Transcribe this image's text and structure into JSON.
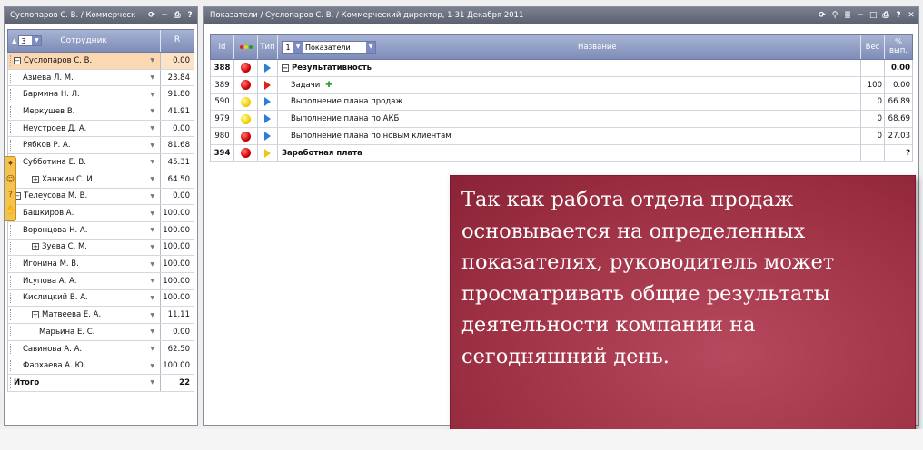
{
  "left_panel": {
    "title": "Суслопаров С. В. / Коммерческ",
    "header": {
      "level_value": "3",
      "employee_col": "Сотрудник",
      "r_col": "R"
    },
    "rows": [
      {
        "name": "Суслопаров С. В.",
        "value": "0.00",
        "expander": "−",
        "indent": 0,
        "selected": true
      },
      {
        "name": "Азиева Л. М.",
        "value": "23.84",
        "indent": 1
      },
      {
        "name": "Бармина Н. Л.",
        "value": "91.80",
        "indent": 1
      },
      {
        "name": "Меркушев В.",
        "value": "41.91",
        "indent": 1
      },
      {
        "name": "Неустроев Д. А.",
        "value": "0.00",
        "indent": 1
      },
      {
        "name": "Рябков Р. А.",
        "value": "81.68",
        "indent": 1
      },
      {
        "name": "Субботина Е. В.",
        "value": "45.31",
        "indent": 1
      },
      {
        "name": "Ханжин С. И.",
        "value": "64.50",
        "expander": "+",
        "indent": 2
      },
      {
        "name": "Телеусова М. В.",
        "value": "0.00",
        "expander": "−",
        "indent": 0
      },
      {
        "name": "Башкиров А.",
        "value": "100.00",
        "indent": 1
      },
      {
        "name": "Воронцова Н. А.",
        "value": "100.00",
        "indent": 1
      },
      {
        "name": "Зуева С. М.",
        "value": "100.00",
        "expander": "+",
        "indent": 2
      },
      {
        "name": "Игонина М. В.",
        "value": "100.00",
        "indent": 1
      },
      {
        "name": "Исупова А. А.",
        "value": "100.00",
        "indent": 1
      },
      {
        "name": "Кислицкий В. А.",
        "value": "100.00",
        "indent": 1
      },
      {
        "name": "Матвеева Е. А.",
        "value": "11.11",
        "expander": "−",
        "indent": 2
      },
      {
        "name": "Марьина Е. С.",
        "value": "0.00",
        "indent": 3
      },
      {
        "name": "Савинова А. А.",
        "value": "62.50",
        "indent": 1
      },
      {
        "name": "Фархаева А. Ю.",
        "value": "100.00",
        "indent": 1
      },
      {
        "name": "Итого",
        "value": "22",
        "indent": 0,
        "total": true
      }
    ]
  },
  "right_panel": {
    "title": "Показатели / Суслопаров С. В. / Коммерческий директор, 1-31 Декабря 2011",
    "header": {
      "id": "id",
      "type": "Тип",
      "level_value": "1",
      "indicators_select": "Показатели",
      "name": "Название",
      "weight": "Вес",
      "pct_line1": "%",
      "pct_line2": "вып."
    },
    "rows": [
      {
        "id": "388",
        "status": "red",
        "flag": "blue",
        "name": "Результативность",
        "expander": "−",
        "weight": "",
        "pct": "0.00",
        "bold": true
      },
      {
        "id": "389",
        "status": "red",
        "flag": "red",
        "name": "Задачи",
        "add": "✚",
        "weight": "100",
        "pct": "0.00",
        "indent": true
      },
      {
        "id": "590",
        "status": "yellow",
        "flag": "blue",
        "name": "Выполнение плана продаж",
        "weight": "0",
        "pct": "66.89",
        "indent": true
      },
      {
        "id": "979",
        "status": "yellow",
        "flag": "blue",
        "name": "Выполнение плана по АКБ",
        "weight": "0",
        "pct": "68.69",
        "indent": true
      },
      {
        "id": "980",
        "status": "red",
        "flag": "blue",
        "name": "Выполнение плана по новым клиентам",
        "weight": "0",
        "pct": "27.03",
        "indent": true
      },
      {
        "id": "394",
        "status": "red",
        "flag": "yellow",
        "name": "Заработная плата",
        "weight": "",
        "pct": "?",
        "bold": true
      }
    ]
  },
  "callout": {
    "lines": [
      "Так как работа отдела продаж",
      "основывается на определенных",
      "показателях, руководитель может",
      "просматривать общие результаты",
      "деятельности компании на",
      "сегодняшний день."
    ]
  },
  "colors": {
    "callout": "#a13347",
    "header": "#7e8db8",
    "selected_row": "#fde3c6"
  }
}
